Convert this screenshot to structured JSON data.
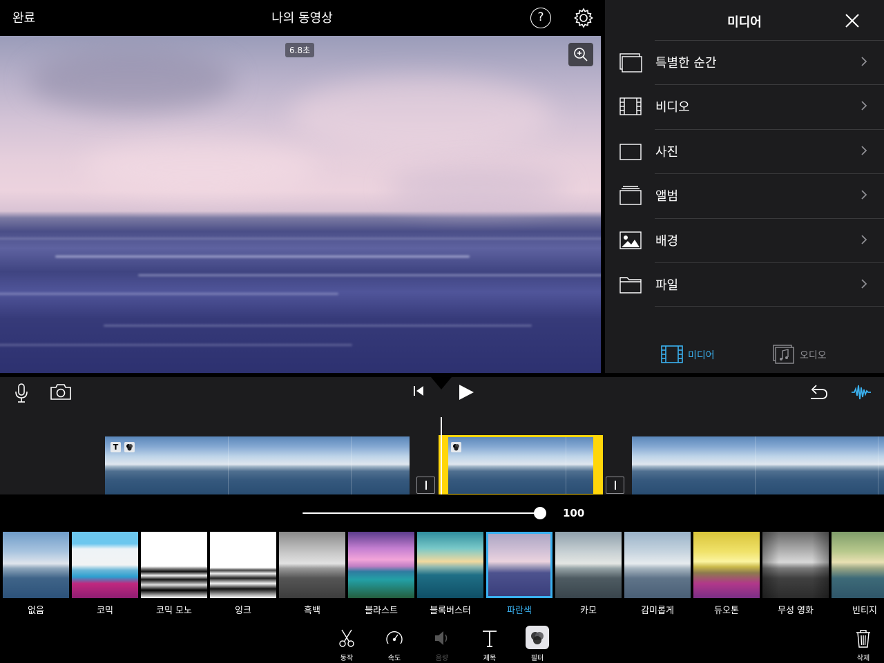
{
  "topbar": {
    "done_label": "완료",
    "project_title": "나의 동영상",
    "help_label": "?"
  },
  "viewer": {
    "duration_badge": "6.8초"
  },
  "media_panel": {
    "title": "미디어",
    "items": [
      {
        "label": "특별한 순간",
        "icon": "moments-icon"
      },
      {
        "label": "비디오",
        "icon": "film-icon"
      },
      {
        "label": "사진",
        "icon": "photo-icon"
      },
      {
        "label": "앨범",
        "icon": "album-icon"
      },
      {
        "label": "배경",
        "icon": "background-icon"
      },
      {
        "label": "파일",
        "icon": "folder-icon"
      }
    ],
    "tabs": [
      {
        "label": "미디어",
        "selected": true
      },
      {
        "label": "오디오",
        "selected": false
      }
    ]
  },
  "timeline": {
    "clip_badges": [
      "T"
    ]
  },
  "filter_intensity": {
    "value": "100",
    "level": 1.0
  },
  "filters": [
    {
      "label": "없음"
    },
    {
      "label": "코믹"
    },
    {
      "label": "코믹 모노"
    },
    {
      "label": "잉크"
    },
    {
      "label": "흑백"
    },
    {
      "label": "블라스트"
    },
    {
      "label": "블록버스터"
    },
    {
      "label": "파란색",
      "selected": true
    },
    {
      "label": "카모"
    },
    {
      "label": "감미롭게"
    },
    {
      "label": "듀오톤"
    },
    {
      "label": "무성 영화"
    },
    {
      "label": "빈티지"
    }
  ],
  "toolbar": {
    "tools": [
      {
        "label": "동작",
        "icon": "scissors-icon"
      },
      {
        "label": "속도",
        "icon": "speedometer-icon"
      },
      {
        "label": "음량",
        "icon": "volume-icon",
        "disabled": true
      },
      {
        "label": "제목",
        "icon": "title-icon"
      },
      {
        "label": "필터",
        "icon": "filter-icon",
        "selected": true
      }
    ],
    "delete_label": "삭제"
  },
  "colors": {
    "accent": "#3ab1f0",
    "selection": "#ffd60a",
    "panel_bg": "#1c1c1e"
  }
}
